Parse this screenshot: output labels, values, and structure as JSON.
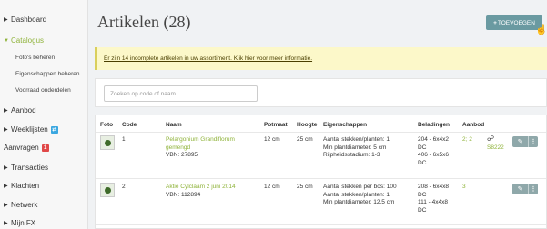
{
  "sidebar": {
    "dashboard": "Dashboard",
    "catalogus": "Catalogus",
    "fotos": "Foto's beheren",
    "eigenschappen": "Eigenschappen beheren",
    "voorraad": "Voorraad onderdelen",
    "aanbod": "Aanbod",
    "weeklijsten": "Weeklijsten",
    "aanvragen": "Aanvragen",
    "aanvragen_badge": "1",
    "transacties": "Transacties",
    "klachten": "Klachten",
    "netwerk": "Netwerk",
    "mijnfx": "Mijn FX"
  },
  "header": {
    "title": "Artikelen (28)",
    "add_button": "TOEVOEGEN"
  },
  "alert": "Er zijn 14 incomplete artikelen in uw assortiment. Klik hier voor meer informatie.",
  "search": {
    "placeholder": "Zoeken op code of naam..."
  },
  "table": {
    "headers": [
      "Foto",
      "Code",
      "Naam",
      "Potmaat",
      "Hoogte",
      "Eigenschappen",
      "Beladingen",
      "Aanbod"
    ],
    "rows": [
      {
        "code": "1",
        "name_line1": "Pelargonium Grandiflorum",
        "name_line2": "gemengd",
        "vbn": "VBN: 27895",
        "potmaat": "12 cm",
        "hoogte": "25 cm",
        "eig1": "Aantal stekken/planten: 1",
        "eig2": "Min plantdiameter: 5 cm",
        "eig3": "Rijpheidsstadium: 1-3",
        "bel1": "204 - 6x4x2",
        "bel2": "DC",
        "bel3": "406 - 6x5x6",
        "bel4": "DC",
        "aanbod": "2; 2",
        "link_code": "S8222"
      },
      {
        "code": "2",
        "name_line1": "Aktie Cylclaam 2 juni 2014",
        "vbn": "VBN: 112894",
        "potmaat": "12 cm",
        "hoogte": "25 cm",
        "eig1": "Aantal stekken per bos: 100",
        "eig2": "Aantal stekken/planten: 1",
        "eig3": "Min plantdiameter: 12,5 cm",
        "bel1": "208 - 6x4x8",
        "bel2": "DC",
        "bel3": "111 - 4x4x8",
        "bel4": "DC",
        "aanbod": "3"
      }
    ]
  },
  "colors": {
    "accent": "#8fb33a",
    "button": "#6a9aa1",
    "weeklijsten_badge": "#3aa7e0",
    "aanvragen_badge": "#e04848"
  }
}
